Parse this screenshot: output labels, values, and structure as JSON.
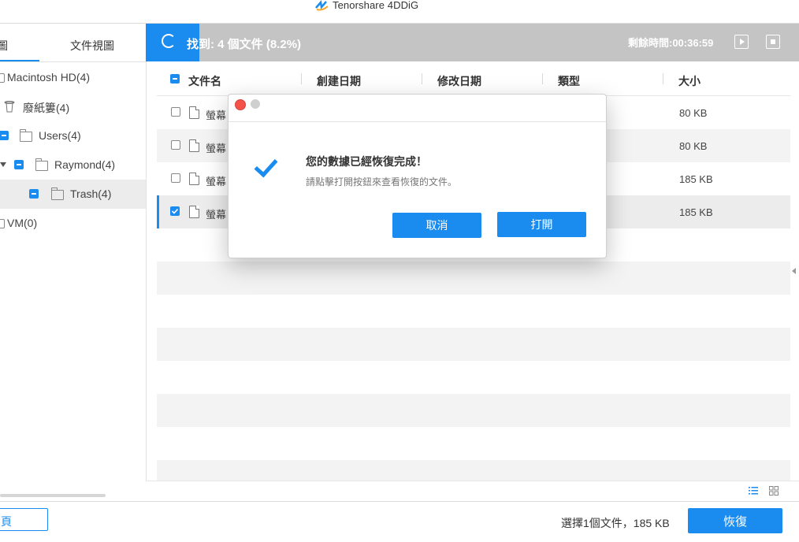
{
  "app": {
    "title": "Tenorshare 4DDiG"
  },
  "left_panel": {
    "tabs": [
      "圖",
      "文件視圖"
    ],
    "tree": [
      {
        "label": "Macintosh HD(4)"
      },
      {
        "label": "廢紙簍(4)"
      },
      {
        "label": "Users(4)"
      },
      {
        "label": "Raymond(4)"
      },
      {
        "label": "Trash(4)"
      },
      {
        "label": "VM(0)"
      }
    ]
  },
  "scan": {
    "found_text": "找到: 4 個文件 (8.2%)",
    "progress_percent": 8.2,
    "remaining_text": "剩餘時間:00:36:59"
  },
  "table": {
    "headers": [
      "文件名",
      "創建日期",
      "修改日期",
      "類型",
      "大小"
    ],
    "rows": [
      {
        "name": "螢幕",
        "size": "80 KB",
        "checked": false
      },
      {
        "name": "螢幕",
        "size": "80 KB",
        "checked": false
      },
      {
        "name": "螢幕",
        "size": "185 KB",
        "checked": false
      },
      {
        "name": "螢幕",
        "size": "185 KB",
        "checked": true
      }
    ]
  },
  "dialog": {
    "title": "您的數據已經恢復完成！",
    "subtitle": "請點擊打開按鈕來查看恢復的文件。",
    "cancel_label": "取消",
    "open_label": "打開"
  },
  "footer": {
    "home_label": "頁",
    "selection_text": "選擇1個文件，185 KB",
    "recover_label": "恢復"
  },
  "colors": {
    "accent": "#1a8cf0",
    "progress_track": "#c4c4c4",
    "close_dot": "#f5534a"
  }
}
